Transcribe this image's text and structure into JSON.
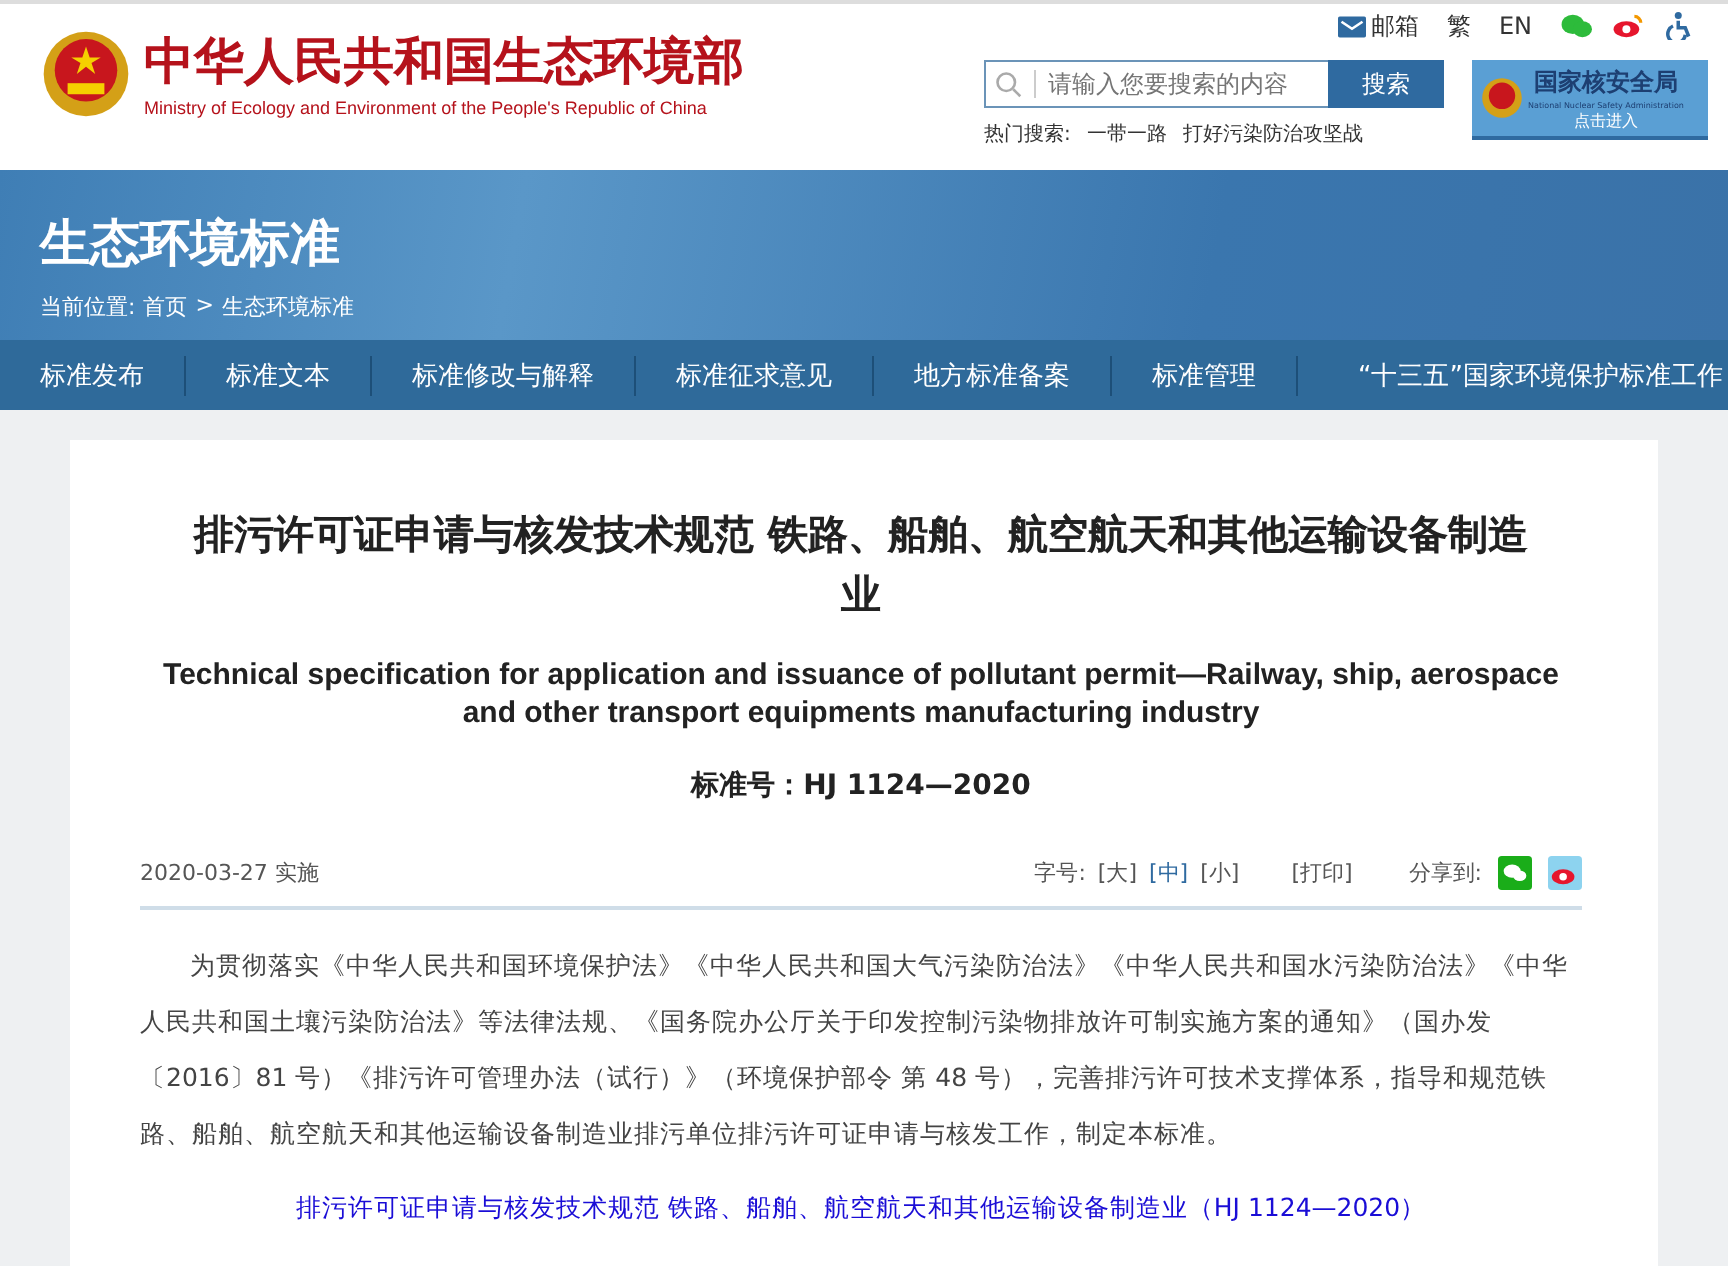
{
  "header": {
    "site_name": "中华人民共和国生态环境部",
    "site_name_en": "Ministry of Ecology and Environment of the People's Republic of China",
    "top_links": [
      "邮箱",
      "繁",
      "EN"
    ],
    "search": {
      "placeholder": "请输入您要搜索的内容",
      "button": "搜索"
    },
    "hot_search": {
      "label": "热门搜索:",
      "terms": [
        "一带一路",
        "打好污染防治攻坚战"
      ]
    },
    "nnsa_banner": {
      "name": "国家核安全局",
      "name_en": "National Nuclear Safety Administration",
      "action": "点击进入"
    }
  },
  "banner": {
    "title": "生态环境标准",
    "breadcrumb_label": "当前位置:",
    "breadcrumb": [
      "首页",
      "生态环境标准"
    ],
    "separator": ">"
  },
  "nav": [
    {
      "label": "标准发布"
    },
    {
      "label": "标准文本"
    },
    {
      "label": "标准修改与解释"
    },
    {
      "label": "标准征求意见"
    },
    {
      "label": "地方标准备案"
    },
    {
      "label": "标准管理"
    },
    {
      "label": "“十三五”国家环境保护标准工作"
    }
  ],
  "article": {
    "title": "排污许可证申请与核发技术规范 铁路、船舶、航空航天和其他运输设备制造业",
    "title_en": "Technical specification for application and issuance of pollutant permit—Railway, ship, aerospace and other transport equipments manufacturing industry",
    "standard_no": "标准号：HJ 1124—2020",
    "date": "2020-03-27 实施",
    "font_size_label": "字号:",
    "font_sizes": [
      {
        "label": "[大]",
        "selected": false
      },
      {
        "label": "[中]",
        "selected": true
      },
      {
        "label": "[小]",
        "selected": false
      }
    ],
    "print": "[打印]",
    "share_label": "分享到:",
    "body": "为贯彻落实《中华人民共和国环境保护法》《中华人民共和国大气污染防治法》《中华人民共和国水污染防治法》《中华人民共和国土壤污染防治法》等法律法规、《国务院办公厅关于印发控制污染物排放许可制实施方案的通知》（国办发〔2016〕81 号）《排污许可管理办法（试行）》（环境保护部令 第 48 号），完善排污许可技术支撑体系，指导和规范铁路、船舶、航空航天和其他运输设备制造业排污单位排污许可证申请与核发工作，制定本标准。",
    "download_link": "排污许可证申请与核发技术规范 铁路、船舶、航空航天和其他运输设备制造业（HJ 1124—2020）"
  }
}
